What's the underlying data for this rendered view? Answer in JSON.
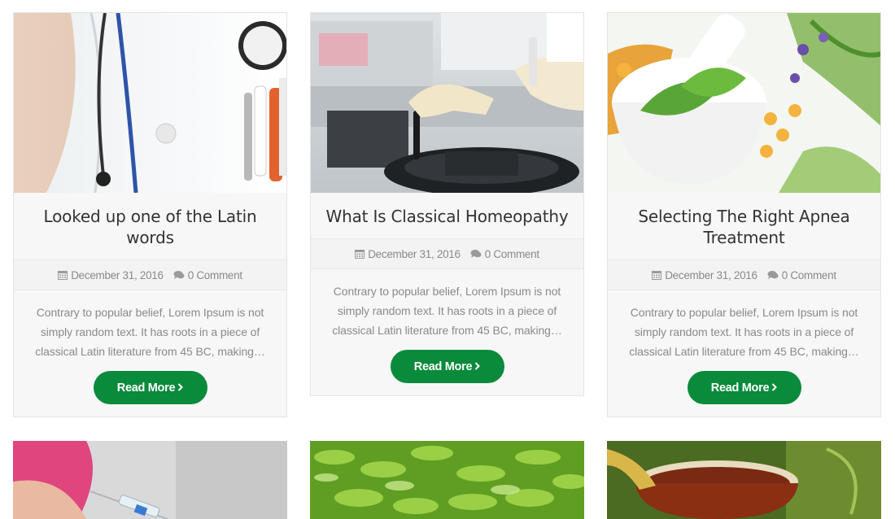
{
  "posts": [
    {
      "title": "Looked up one of the Latin words",
      "date": "December 31, 2016",
      "comments": "0 Comment",
      "excerpt": "Contrary to popular belief, Lorem Ipsum is not simply random text. It has roots in a piece of classical Latin literature from 45 BC, making…",
      "button": "Read More",
      "image_icon": "doctor-coat-image"
    },
    {
      "title": "What Is Classical Homeopathy",
      "date": "December 31, 2016",
      "comments": "0 Comment",
      "excerpt": "Contrary to popular belief, Lorem Ipsum is not simply random text. It has roots in a piece of classical Latin literature from 45 BC, making…",
      "button": "Read More",
      "image_icon": "lab-centrifuge-image"
    },
    {
      "title": "Selecting The Right Apnea Treatment",
      "date": "December 31, 2016",
      "comments": "0 Comment",
      "excerpt": "Contrary to popular belief, Lorem Ipsum is not simply random text. It has roots in a piece of classical Latin literature from 45 BC, making…",
      "button": "Read More",
      "image_icon": "herbal-mortar-image"
    }
  ],
  "bottom_row": [
    {
      "image_icon": "injection-image"
    },
    {
      "image_icon": "tea-leaves-image"
    },
    {
      "image_icon": "tea-cup-image"
    }
  ],
  "colors": {
    "accent": "#0a8a3b",
    "muted_text": "#8a8a8a",
    "card_bg": "#f7f7f7"
  }
}
